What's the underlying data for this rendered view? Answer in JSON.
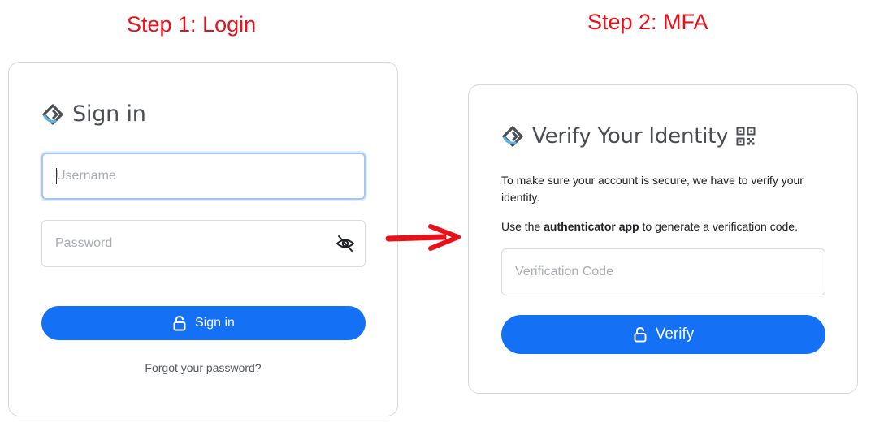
{
  "steps": {
    "step1_title": "Step 1: Login",
    "step2_title": "Step 2: MFA"
  },
  "login": {
    "heading": "Sign in",
    "username_placeholder": "Username",
    "password_placeholder": "Password",
    "submit_label": "Sign in",
    "forgot_link": "Forgot your password?"
  },
  "mfa": {
    "heading": "Verify Your Identity",
    "intro": "To make sure your account is secure, we have to verify your identity.",
    "instruction_prefix": "Use the ",
    "instruction_bold": "authenticator app",
    "instruction_suffix": " to generate a verification code.",
    "code_placeholder": "Verification Code",
    "submit_label": "Verify"
  },
  "colors": {
    "step_title": "#e8111a",
    "primary_button": "#1470f5",
    "arrow": "#e8111a",
    "logo_dark": "#4a4d52",
    "logo_accent": "#5bb4e8"
  },
  "icons": {
    "logo": "brand-logo-icon",
    "qr": "qr-code-icon",
    "password_toggle": "eye-slash-icon",
    "lock": "lock-icon",
    "arrow": "arrow-right-icon"
  }
}
